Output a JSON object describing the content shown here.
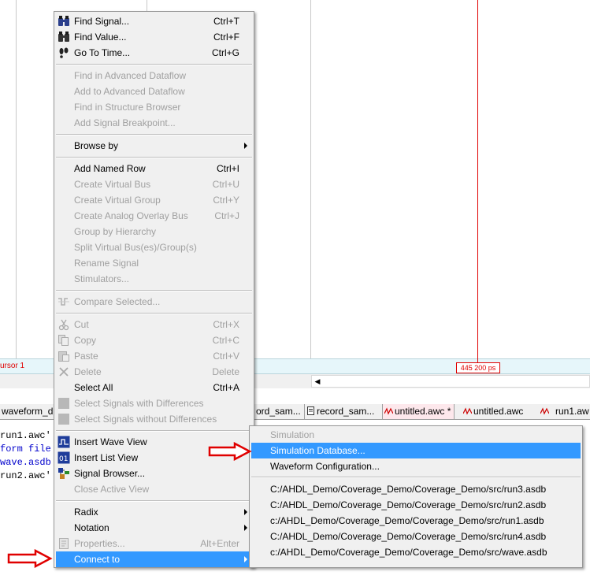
{
  "waveform": {
    "cursor_label": "ursor 1",
    "cursor_time": "445 200 ps"
  },
  "tabs": [
    {
      "label": "waveform_d",
      "icon": "waveform-icon"
    },
    {
      "label": "ord_sam...",
      "icon": "waveform-icon"
    },
    {
      "label": "record_sam...",
      "icon": "document-icon"
    },
    {
      "label": "untitled.awc *",
      "icon": "waveform-icon"
    },
    {
      "label": "untitled.awc",
      "icon": "waveform-icon"
    },
    {
      "label": "run1.aw",
      "icon": "waveform-icon"
    }
  ],
  "console": {
    "lines": [
      "run1.awc'",
      "form file",
      "wave.asdb",
      "run2.awc'"
    ],
    "colors": {
      "normal": "#000000",
      "link": "#0000cc"
    }
  },
  "menu": {
    "find_signal": {
      "label": "Find Signal...",
      "shortcut": "Ctrl+T",
      "icon": "binoculars-icon"
    },
    "find_value": {
      "label": "Find Value...",
      "shortcut": "Ctrl+F",
      "icon": "binoculars-icon"
    },
    "go_to_time": {
      "label": "Go To Time...",
      "shortcut": "Ctrl+G",
      "icon": "footprints-icon"
    },
    "find_adv_dataflow": {
      "label": "Find in Advanced Dataflow"
    },
    "add_adv_dataflow": {
      "label": "Add to Advanced Dataflow"
    },
    "find_structure": {
      "label": "Find in Structure Browser"
    },
    "add_breakpoint": {
      "label": "Add Signal Breakpoint..."
    },
    "browse_by": {
      "label": "Browse by"
    },
    "add_named_row": {
      "label": "Add Named Row",
      "shortcut": "Ctrl+I"
    },
    "create_virtual_bus": {
      "label": "Create Virtual Bus",
      "shortcut": "Ctrl+U"
    },
    "create_virtual_group": {
      "label": "Create Virtual Group",
      "shortcut": "Ctrl+Y"
    },
    "create_analog_overlay": {
      "label": "Create Analog Overlay Bus",
      "shortcut": "Ctrl+J"
    },
    "group_by_hierarchy": {
      "label": "Group by Hierarchy"
    },
    "split_virtual_bus": {
      "label": "Split Virtual Bus(es)/Group(s)"
    },
    "rename_signal": {
      "label": "Rename Signal"
    },
    "stimulators": {
      "label": "Stimulators..."
    },
    "compare_selected": {
      "label": "Compare Selected...",
      "icon": "compare-icon"
    },
    "cut": {
      "label": "Cut",
      "shortcut": "Ctrl+X",
      "icon": "scissors-icon"
    },
    "copy": {
      "label": "Copy",
      "shortcut": "Ctrl+C",
      "icon": "copy-icon"
    },
    "paste": {
      "label": "Paste",
      "shortcut": "Ctrl+V",
      "icon": "paste-icon"
    },
    "delete": {
      "label": "Delete",
      "shortcut": "Delete",
      "icon": "delete-x-icon"
    },
    "select_all": {
      "label": "Select All",
      "shortcut": "Ctrl+A"
    },
    "select_with_diff": {
      "label": "Select Signals with Differences",
      "icon": "select-diff-icon"
    },
    "select_without_diff": {
      "label": "Select Signals without Differences",
      "icon": "select-nodiff-icon"
    },
    "insert_wave_view": {
      "label": "Insert Wave View",
      "icon": "wave-view-icon"
    },
    "insert_list_view": {
      "label": "Insert List View",
      "icon": "list-view-icon"
    },
    "signal_browser": {
      "label": "Signal Browser...",
      "icon": "signal-browser-icon"
    },
    "close_active_view": {
      "label": "Close Active View"
    },
    "radix": {
      "label": "Radix"
    },
    "notation": {
      "label": "Notation"
    },
    "properties": {
      "label": "Properties...",
      "shortcut": "Alt+Enter",
      "icon": "properties-icon"
    },
    "connect_to": {
      "label": "Connect to"
    }
  },
  "submenu": {
    "header": "Simulation",
    "items": [
      "Simulation Database...",
      "Waveform Configuration...",
      "C:/AHDL_Demo/Coverage_Demo/Coverage_Demo/src/run3.asdb",
      "C:/AHDL_Demo/Coverage_Demo/Coverage_Demo/src/run2.asdb",
      "c:/AHDL_Demo/Coverage_Demo/Coverage_Demo/src/run1.asdb",
      "C:/AHDL_Demo/Coverage_Demo/Coverage_Demo/src/run4.asdb",
      "c:/AHDL_Demo/Coverage_Demo/Coverage_Demo/src/wave.asdb"
    ]
  },
  "colors": {
    "highlight": "#3399ff",
    "annotation_arrow": "#e00000",
    "cursor": "#e00000",
    "disabled_text": "#a0a0a0"
  }
}
